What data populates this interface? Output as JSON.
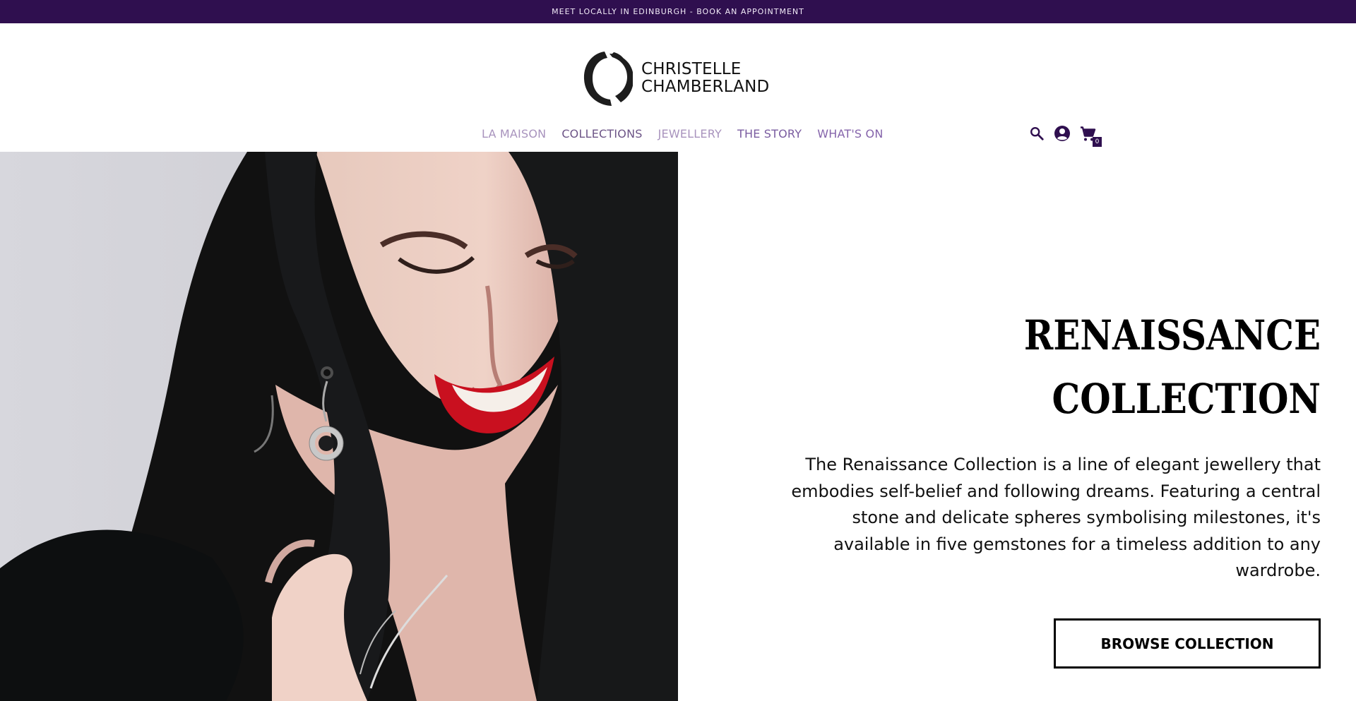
{
  "announcement": {
    "text": "MEET LOCALLY IN EDINBURGH - BOOK AN APPOINTMENT",
    "background": "#2f0f4f"
  },
  "header": {
    "brand": {
      "line1": "CHRISTELLE",
      "line2": "CHAMBERLAND",
      "mark": "circle-c-logo"
    },
    "nav": [
      {
        "label": "LA MAISON"
      },
      {
        "label": "COLLECTIONS"
      },
      {
        "label": "JEWELLERY"
      },
      {
        "label": "THE STORY"
      },
      {
        "label": "WHAT'S ON"
      }
    ],
    "icons": {
      "search": "search-icon",
      "account": "account-icon",
      "cart": "cart-icon"
    },
    "cart_count": "0"
  },
  "hero": {
    "image": "portrait of woman wearing Renaissance earring and necklace",
    "title_line1": "RENAISSANCE",
    "title_line2": "COLLECTION",
    "text": "The Renaissance Collection is a line of elegant jewellery that embodies self-belief and following dreams. Featuring a central stone and delicate spheres symbolising milestones, it's available in five gemstones for a timeless addition to any wardrobe.",
    "button_label": "BROWSE COLLECTION"
  },
  "colors": {
    "accent": "#2f0f4f",
    "nav": "#8564ab",
    "text": "#111111"
  }
}
